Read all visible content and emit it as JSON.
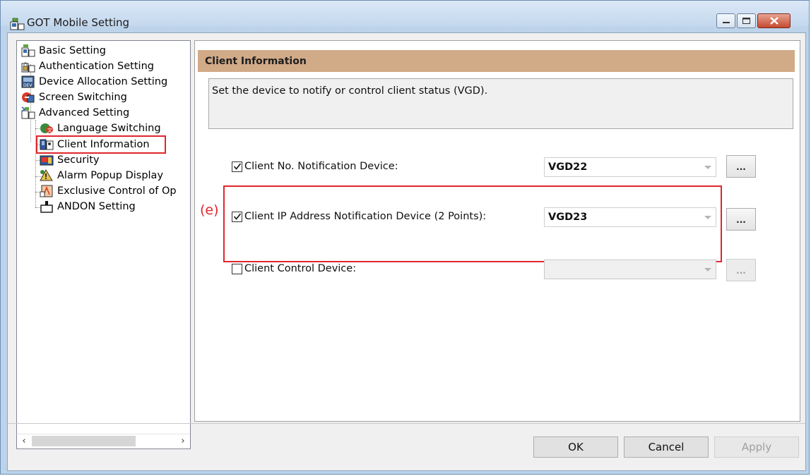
{
  "window": {
    "title": "GOT Mobile Setting"
  },
  "tree": {
    "items": [
      {
        "label": "Basic Setting",
        "icon": "basic-setting-icon"
      },
      {
        "label": "Authentication Setting",
        "icon": "authentication-icon"
      },
      {
        "label": "Device Allocation Setting",
        "icon": "device-allocation-icon"
      },
      {
        "label": "Screen Switching",
        "icon": "screen-switching-icon"
      },
      {
        "label": "Advanced Setting",
        "icon": "advanced-setting-icon"
      },
      {
        "label": "Language Switching",
        "icon": "language-switching-icon"
      },
      {
        "label": "Client Information",
        "icon": "client-information-icon",
        "selected": true
      },
      {
        "label": "Security",
        "icon": "security-icon"
      },
      {
        "label": "Alarm Popup Display",
        "icon": "alarm-popup-icon"
      },
      {
        "label": "Exclusive Control of Op",
        "icon": "exclusive-control-icon"
      },
      {
        "label": "ANDON Setting",
        "icon": "andon-icon"
      }
    ]
  },
  "section": {
    "title": "Client Information",
    "description": "Set the device to notify or control client status (VGD)."
  },
  "annotation": {
    "marker": "(e)",
    "color": "#e0262b"
  },
  "settings": {
    "client_no": {
      "label": "Client No. Notification Device:",
      "checked": true,
      "value": "VGD22",
      "browse": "..."
    },
    "client_ip": {
      "label": "Client IP Address Notification Device (2 Points):",
      "checked": true,
      "value": "VGD23",
      "browse": "..."
    },
    "client_control": {
      "label": "Client Control Device:",
      "checked": false,
      "value": "",
      "browse": "...",
      "enabled": false
    }
  },
  "buttons": {
    "ok": "OK",
    "cancel": "Cancel",
    "apply": "Apply"
  },
  "colors": {
    "section_header": "#d1aa88",
    "title_bar": "#c4d8ee",
    "highlight": "#e0262b"
  }
}
